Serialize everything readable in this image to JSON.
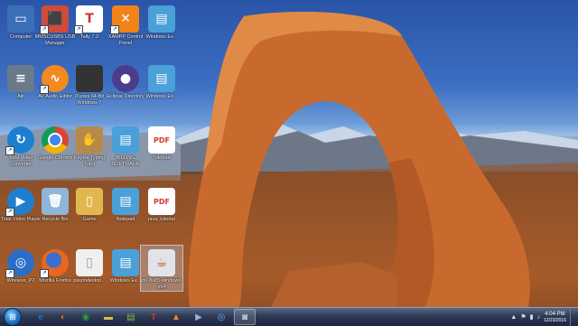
{
  "desktop": {
    "icons": [
      {
        "label": "Computer",
        "glyph": "▭",
        "color": "#3b6fb8"
      },
      {
        "label": "MMSCUSBS USB Manager",
        "glyph": "⬛",
        "color": "#d04b3a"
      },
      {
        "label": "Tally 7.2",
        "glyph": "T",
        "color": "#d0323a"
      },
      {
        "label": "XAMPP Control Panel",
        "glyph": "✕",
        "color": "#f2821a"
      },
      {
        "label": "Windows Ex...",
        "glyph": "▤",
        "color": "#4aa0d8"
      },
      {
        "label": "Ajit",
        "glyph": "≡",
        "color": "#6a7a8a"
      },
      {
        "label": "AV Audio Editor",
        "glyph": "∿",
        "color": "#f28a20"
      },
      {
        "label": "iTunes 64-Bit Windows 7",
        "glyph": "",
        "color": "#333333"
      },
      {
        "label": "Eclipse Directory",
        "glyph": "●",
        "color": "#4b3c8c"
      },
      {
        "label": "Windows Ex...",
        "glyph": "▤",
        "color": "#4aa0d8"
      },
      {
        "label": "Total Video Converter",
        "glyph": "↻",
        "color": "#1d7fd0"
      },
      {
        "label": "Google Chrome",
        "glyph": "◉",
        "color": "#2f9d3f"
      },
      {
        "label": "KeyRa Typing Tutor",
        "glyph": "✋",
        "color": "#b58a4a"
      },
      {
        "label": "BILLING SOFTWARE",
        "glyph": "▤",
        "color": "#4aa0d8"
      },
      {
        "label": "Tutorials",
        "glyph": "PDF",
        "color": "#d33a2e"
      },
      {
        "label": "Total Video Player",
        "glyph": "▶",
        "color": "#1d7fd0"
      },
      {
        "label": "Recycle Bin",
        "glyph": "🗑",
        "color": "#8fb6d8"
      },
      {
        "label": "Game",
        "glyph": "▯",
        "color": "#e1b850"
      },
      {
        "label": "Notepad",
        "glyph": "▤",
        "color": "#4aa0d8"
      },
      {
        "label": "java_tutorial",
        "glyph": "PDF",
        "color": "#d33a2e"
      },
      {
        "label": "Wireless_P2",
        "glyph": "◎",
        "color": "#2a6ec8"
      },
      {
        "label": "Mozilla Firefox",
        "glyph": "◐",
        "color": "#e8661e"
      },
      {
        "label": "playtodeskto...",
        "glyph": "▯",
        "color": "#f0f0f0"
      },
      {
        "label": "Windows Ex...",
        "glyph": "▤",
        "color": "#4aa0d8"
      },
      {
        "label": "jdk-8u65-windows-x64",
        "glyph": "☕",
        "color": "#e0e4ea"
      }
    ]
  },
  "taskbar": {
    "start_label": "⊞",
    "items": [
      {
        "name": "tb-ie",
        "glyph": "e",
        "color": "#1e73c9"
      },
      {
        "name": "tb-firefox",
        "glyph": "◐",
        "color": "#e8661e"
      },
      {
        "name": "tb-chrome",
        "glyph": "◉",
        "color": "#2f9d3f"
      },
      {
        "name": "tb-explorer",
        "glyph": "▬",
        "color": "#e1b850"
      },
      {
        "name": "tb-notepad",
        "glyph": "▤",
        "color": "#7bb84e"
      },
      {
        "name": "tb-tally",
        "glyph": "T",
        "color": "#d0323a"
      },
      {
        "name": "tb-vlc",
        "glyph": "▲",
        "color": "#f28a20"
      },
      {
        "name": "tb-player",
        "glyph": "▶",
        "color": "#3a5f9a"
      },
      {
        "name": "tb-media",
        "glyph": "◎",
        "color": "#2a6ec8"
      },
      {
        "name": "tb-camera",
        "glyph": "◙",
        "color": "#7a8aa0"
      }
    ],
    "tray_icons": [
      "▲",
      "⚑",
      "▮",
      "♪"
    ],
    "clock": {
      "time": "4:04 PM",
      "date": "12/23/2016"
    }
  }
}
